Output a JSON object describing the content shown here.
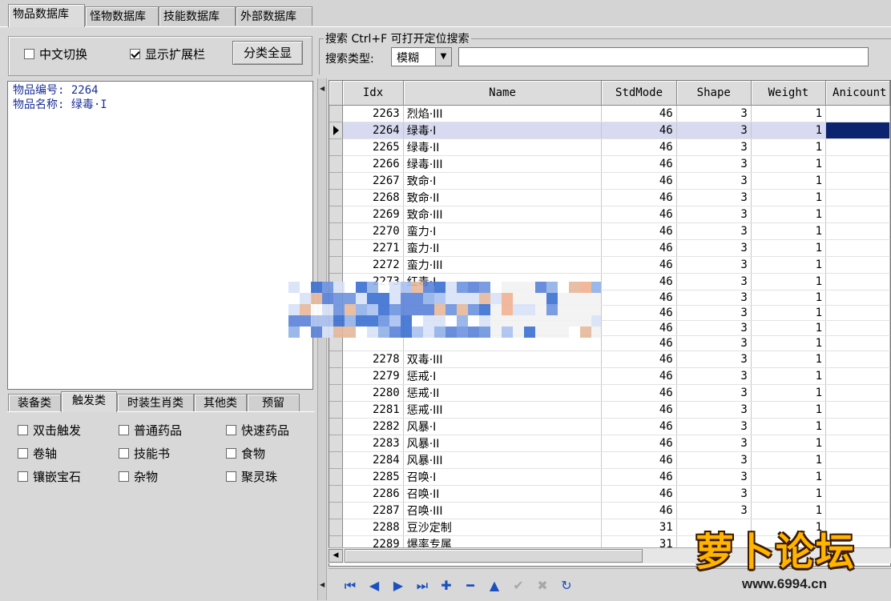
{
  "top_tabs": [
    "物品数据库",
    "怪物数据库",
    "技能数据库",
    "外部数据库"
  ],
  "options": {
    "chinese_switch": {
      "label": "中文切换",
      "checked": false
    },
    "show_ext_bar": {
      "label": "显示扩展栏",
      "checked": true
    },
    "show_all_button": "分类全显"
  },
  "search": {
    "title": "搜索  Ctrl+F 可打开定位搜索",
    "type_label": "搜索类型:",
    "type_value": "模糊",
    "query": ""
  },
  "info": {
    "line1": "物品编号: 2264",
    "line2": "物品名称: 绿毒·I"
  },
  "category_tabs": [
    "装备类",
    "触发类",
    "时装生肖类",
    "其他类",
    "预留"
  ],
  "category_active": 1,
  "trigger_checks": [
    {
      "label": "双击触发",
      "checked": false
    },
    {
      "label": "普通药品",
      "checked": false
    },
    {
      "label": "快速药品",
      "checked": false
    },
    {
      "label": "卷轴",
      "checked": false
    },
    {
      "label": "技能书",
      "checked": false
    },
    {
      "label": "食物",
      "checked": false
    },
    {
      "label": "镶嵌宝石",
      "checked": false
    },
    {
      "label": "杂物",
      "checked": false
    },
    {
      "label": "聚灵珠",
      "checked": false
    }
  ],
  "grid": {
    "columns": [
      "Idx",
      "Name",
      "StdMode",
      "Shape",
      "Weight",
      "Anicount"
    ],
    "selected_idx": "2264",
    "rows": [
      [
        "2263",
        "烈焰·III",
        "46",
        "3",
        "1"
      ],
      [
        "2264",
        "绿毒·I",
        "46",
        "3",
        "1"
      ],
      [
        "2265",
        "绿毒·II",
        "46",
        "3",
        "1"
      ],
      [
        "2266",
        "绿毒·III",
        "46",
        "3",
        "1"
      ],
      [
        "2267",
        "致命·I",
        "46",
        "3",
        "1"
      ],
      [
        "2268",
        "致命·II",
        "46",
        "3",
        "1"
      ],
      [
        "2269",
        "致命·III",
        "46",
        "3",
        "1"
      ],
      [
        "2270",
        "蛮力·I",
        "46",
        "3",
        "1"
      ],
      [
        "2271",
        "蛮力·II",
        "46",
        "3",
        "1"
      ],
      [
        "2272",
        "蛮力·III",
        "46",
        "3",
        "1"
      ],
      [
        "2273",
        "红毒·I",
        "46",
        "3",
        "1"
      ],
      [
        "",
        "",
        "46",
        "3",
        "1"
      ],
      [
        "",
        "",
        "46",
        "3",
        "1"
      ],
      [
        "",
        "",
        "46",
        "3",
        "1"
      ],
      [
        "",
        "",
        "46",
        "3",
        "1"
      ],
      [
        "2278",
        "双毒·III",
        "46",
        "3",
        "1"
      ],
      [
        "2279",
        "惩戒·I",
        "46",
        "3",
        "1"
      ],
      [
        "2280",
        "惩戒·II",
        "46",
        "3",
        "1"
      ],
      [
        "2281",
        "惩戒·III",
        "46",
        "3",
        "1"
      ],
      [
        "2282",
        "风暴·I",
        "46",
        "3",
        "1"
      ],
      [
        "2283",
        "风暴·II",
        "46",
        "3",
        "1"
      ],
      [
        "2284",
        "风暴·III",
        "46",
        "3",
        "1"
      ],
      [
        "2285",
        "召唤·I",
        "46",
        "3",
        "1"
      ],
      [
        "2286",
        "召唤·II",
        "46",
        "3",
        "1"
      ],
      [
        "2287",
        "召唤·III",
        "46",
        "3",
        "1"
      ],
      [
        "2288",
        "豆沙定制",
        "31",
        "",
        "1"
      ],
      [
        "2289",
        "爆率专属",
        "31",
        "",
        "1"
      ]
    ]
  },
  "navigator": [
    {
      "icon": "first-record-icon",
      "glyph": "⏮",
      "enabled": true
    },
    {
      "icon": "prior-record-icon",
      "glyph": "◀",
      "enabled": true
    },
    {
      "icon": "next-record-icon",
      "glyph": "▶",
      "enabled": true
    },
    {
      "icon": "last-record-icon",
      "glyph": "⏭",
      "enabled": true
    },
    {
      "icon": "insert-record-icon",
      "glyph": "✚",
      "enabled": true
    },
    {
      "icon": "delete-record-icon",
      "glyph": "━",
      "enabled": true
    },
    {
      "icon": "edit-record-icon",
      "glyph": "▲",
      "enabled": true
    },
    {
      "icon": "post-record-icon",
      "glyph": "✔",
      "enabled": false
    },
    {
      "icon": "cancel-record-icon",
      "glyph": "✖",
      "enabled": false
    },
    {
      "icon": "refresh-record-icon",
      "glyph": "↻",
      "enabled": true
    }
  ],
  "watermark": {
    "text": "萝卜论坛",
    "url": "www.6994.cn"
  },
  "colors": {
    "selected_row": "#d7daf0",
    "focus_cell": "#0c2470",
    "info_text": "#1a2e98",
    "nav_icon": "#1c4fc0"
  }
}
